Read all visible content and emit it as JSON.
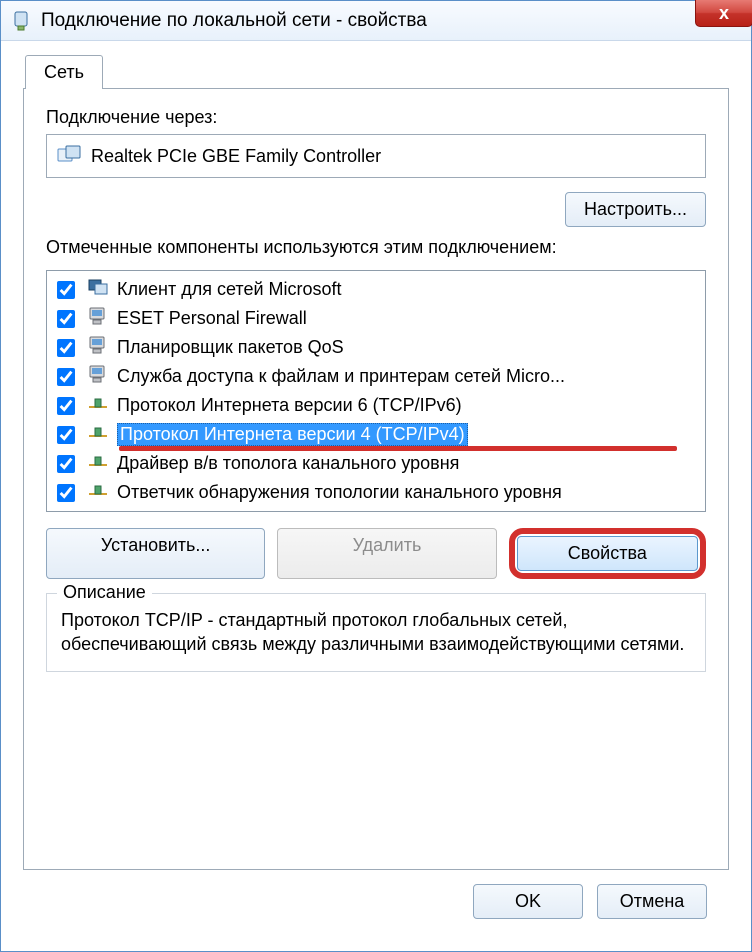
{
  "window": {
    "title": "Подключение по локальной сети - свойства",
    "close_label": "x"
  },
  "tab": {
    "label": "Сеть"
  },
  "connect_via_label": "Подключение через:",
  "adapter": "Realtek PCIe GBE Family Controller",
  "configure_btn": "Настроить...",
  "components_label": "Отмеченные компоненты используются этим подключением:",
  "components": [
    {
      "label": "Клиент для сетей Microsoft",
      "icon": "client"
    },
    {
      "label": "ESET Personal Firewall",
      "icon": "pc"
    },
    {
      "label": "Планировщик пакетов QoS",
      "icon": "pc"
    },
    {
      "label": "Служба доступа к файлам и принтерам сетей Micro...",
      "icon": "pc"
    },
    {
      "label": "Протокол Интернета версии 6 (TCP/IPv6)",
      "icon": "proto"
    },
    {
      "label": "Протокол Интернета версии 4 (TCP/IPv4)",
      "icon": "proto",
      "selected": true
    },
    {
      "label": "Драйвер в/в тополога канального уровня",
      "icon": "proto"
    },
    {
      "label": "Ответчик обнаружения топологии канального уровня",
      "icon": "proto"
    }
  ],
  "buttons": {
    "install": "Установить...",
    "remove": "Удалить",
    "properties": "Свойства"
  },
  "description": {
    "title": "Описание",
    "text": "Протокол TCP/IP - стандартный протокол глобальных сетей, обеспечивающий связь между различными взаимодействующими сетями."
  },
  "footer": {
    "ok": "OK",
    "cancel": "Отмена"
  }
}
